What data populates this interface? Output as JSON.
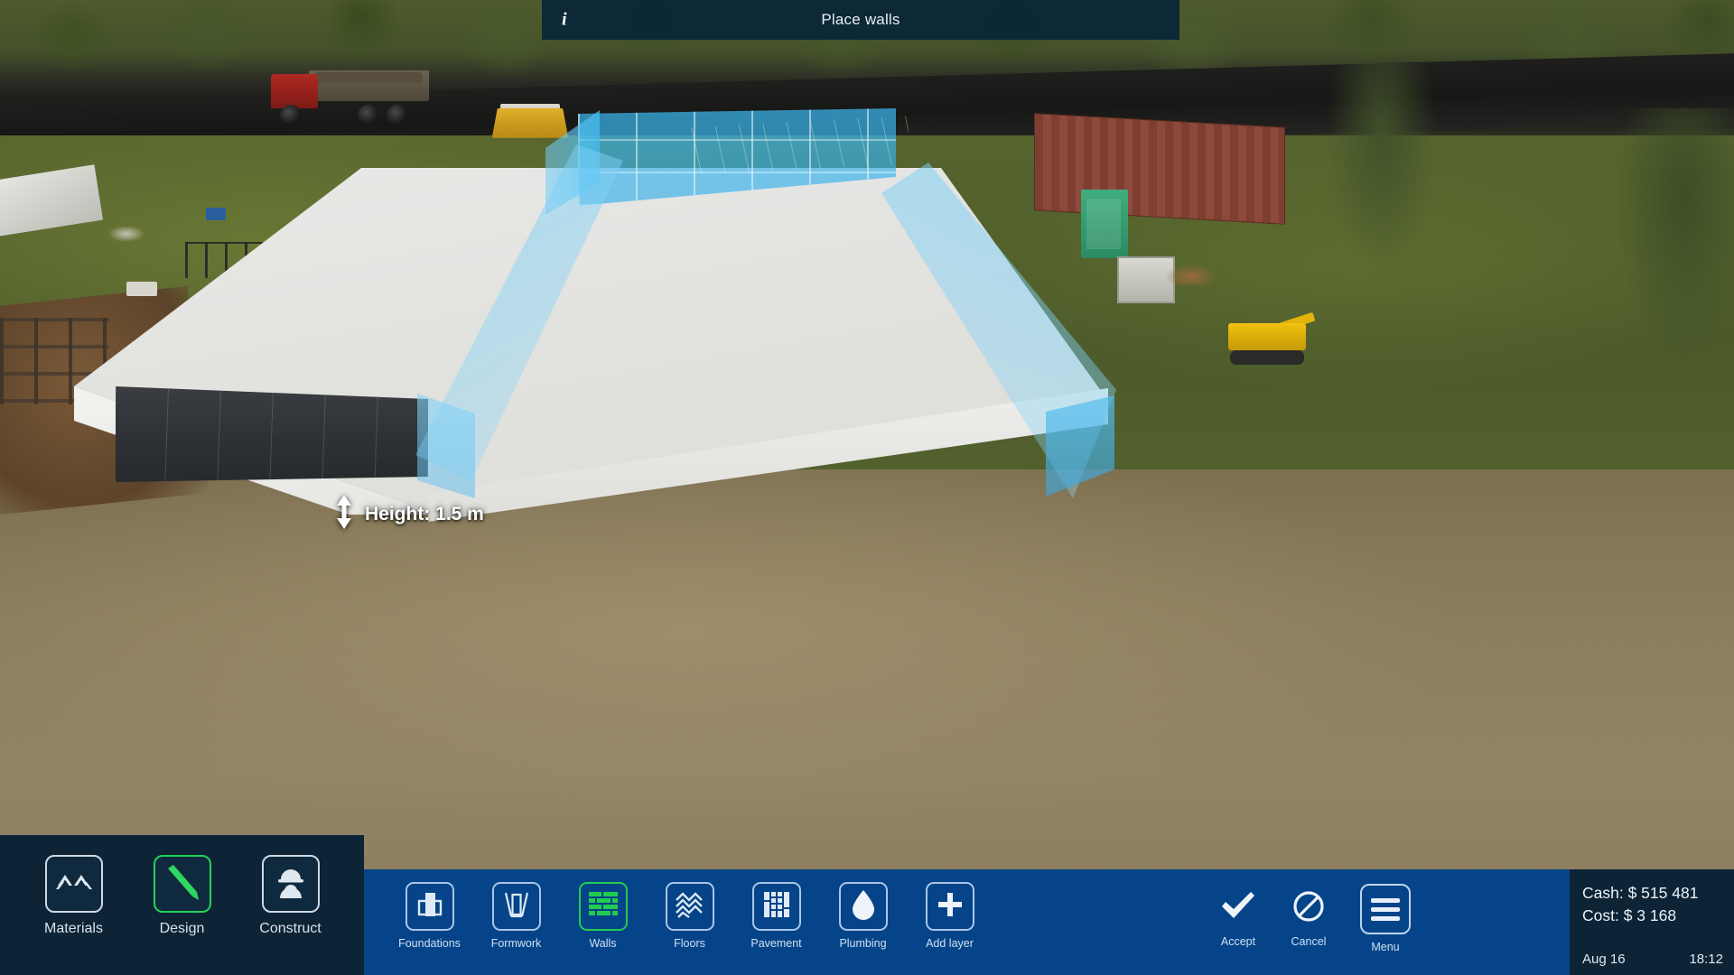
{
  "banner": {
    "info_icon": "info-icon",
    "title": "Place walls"
  },
  "scene": {
    "height_tooltip": {
      "icon": "vertical-resize-arrow-icon",
      "label": "Height: 1.5 m"
    }
  },
  "modes": {
    "items": [
      {
        "label": "Materials",
        "icon": "materials-chevron-icon",
        "active": false
      },
      {
        "label": "Design",
        "icon": "pencil-icon",
        "active": true
      },
      {
        "label": "Construct",
        "icon": "worker-hardhat-icon",
        "active": false
      }
    ]
  },
  "tools": {
    "items": [
      {
        "label": "Foundations",
        "icon": "foundation-block-icon",
        "active": false
      },
      {
        "label": "Formwork",
        "icon": "formwork-frame-icon",
        "active": false
      },
      {
        "label": "Walls",
        "icon": "brick-wall-icon",
        "active": true
      },
      {
        "label": "Floors",
        "icon": "herringbone-floor-icon",
        "active": false
      },
      {
        "label": "Pavement",
        "icon": "pavement-grid-icon",
        "active": false
      },
      {
        "label": "Plumbing",
        "icon": "water-drop-icon",
        "active": false
      },
      {
        "label": "Add layer",
        "icon": "plus-icon",
        "active": false
      }
    ]
  },
  "actions": {
    "accept": {
      "label": "Accept",
      "icon": "checkmark-icon"
    },
    "cancel": {
      "label": "Cancel",
      "icon": "prohibition-icon"
    },
    "menu": {
      "label": "Menu",
      "icon": "hamburger-menu-icon"
    }
  },
  "stats": {
    "cash": "Cash: $ 515 481",
    "cost": "Cost: $ 3 168",
    "date": "Aug 16",
    "time": "18:12"
  },
  "colors": {
    "panel_blue": "#054489",
    "panel_navy": "#0d2436",
    "active_green": "#22cc51",
    "banner_bg": "#092538",
    "ghost_wall": "#46bce8"
  }
}
